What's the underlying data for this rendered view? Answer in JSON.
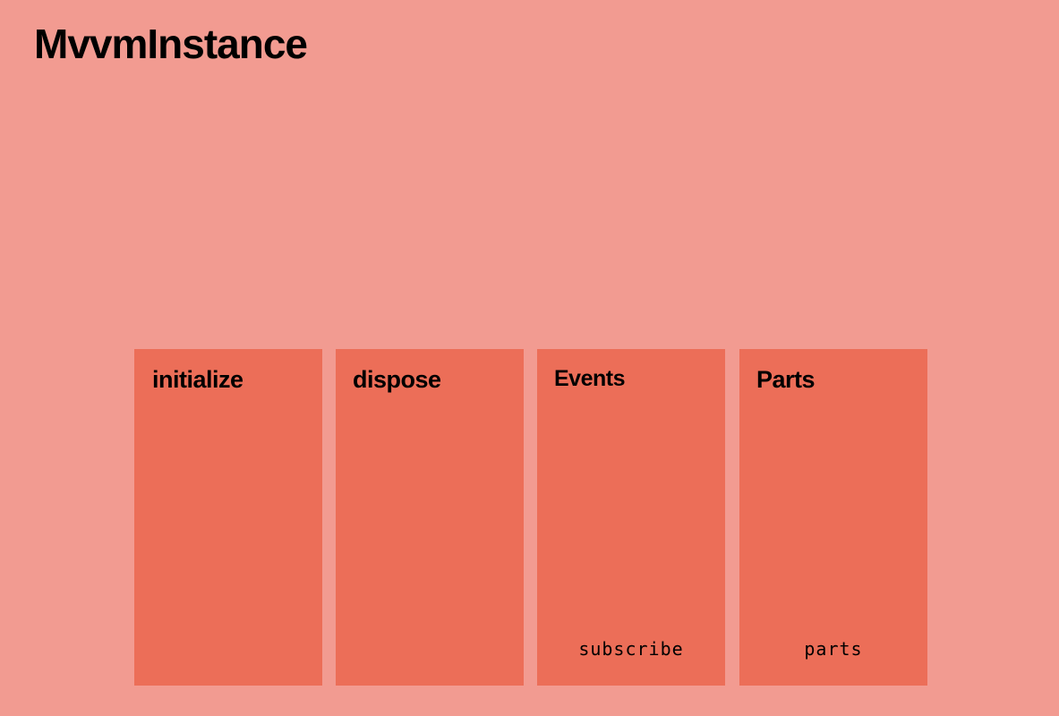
{
  "title": "MvvmInstance",
  "colors": {
    "background": "#f29b91",
    "card": "#ec6e58",
    "text": "#000000"
  },
  "cards": [
    {
      "title": "initialize",
      "code": ""
    },
    {
      "title": "dispose",
      "code": ""
    },
    {
      "title": "Events",
      "code": "subscribe"
    },
    {
      "title": "Parts",
      "code": "parts"
    }
  ]
}
